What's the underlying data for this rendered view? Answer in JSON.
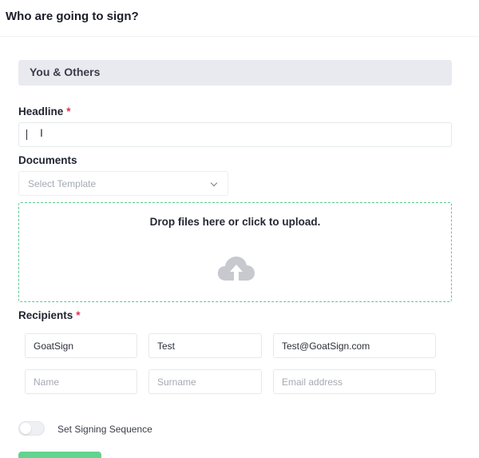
{
  "header": {
    "title": "Who are going to sign?"
  },
  "section": {
    "title": "You & Others"
  },
  "headline": {
    "label": "Headline",
    "required_mark": "*",
    "value": ""
  },
  "documents": {
    "label": "Documents",
    "select_placeholder": "Select Template",
    "dropzone_text": "Drop files here or click to upload."
  },
  "recipients": {
    "label": "Recipients",
    "required_mark": "*",
    "rows": [
      {
        "name": "GoatSign",
        "surname": "Test",
        "email": "Test@GoatSign.com"
      },
      {
        "name": "",
        "surname": "",
        "email": ""
      }
    ],
    "placeholders": {
      "name": "Name",
      "surname": "Surname",
      "email": "Email address"
    }
  },
  "signing_sequence": {
    "label": "Set Signing Sequence",
    "enabled": false
  },
  "colors": {
    "accent": "#63d38f",
    "required": "#e0314b",
    "section_bg": "#e9eaf0"
  },
  "icons": {
    "upload": "cloud-upload-icon",
    "dropdown": "chevron-down-icon"
  }
}
